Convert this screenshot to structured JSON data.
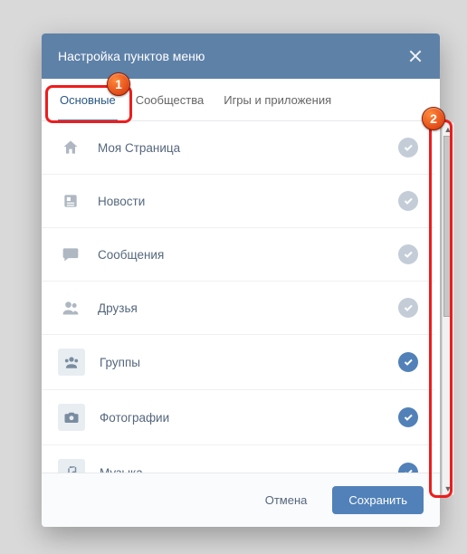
{
  "header": {
    "title": "Настройка пунктов меню"
  },
  "tabs": [
    {
      "label": "Основные",
      "active": true
    },
    {
      "label": "Сообщества",
      "active": false
    },
    {
      "label": "Игры и приложения",
      "active": false
    }
  ],
  "items": [
    {
      "icon": "home-icon",
      "label": "Моя Страница",
      "checked": false,
      "large": false
    },
    {
      "icon": "news-icon",
      "label": "Новости",
      "checked": false,
      "large": false
    },
    {
      "icon": "messages-icon",
      "label": "Сообщения",
      "checked": false,
      "large": false
    },
    {
      "icon": "friends-icon",
      "label": "Друзья",
      "checked": false,
      "large": false
    },
    {
      "icon": "groups-icon",
      "label": "Группы",
      "checked": true,
      "large": true
    },
    {
      "icon": "photos-icon",
      "label": "Фотографии",
      "checked": true,
      "large": true
    },
    {
      "icon": "music-icon",
      "label": "Музыка",
      "checked": true,
      "large": true
    }
  ],
  "footer": {
    "cancel": "Отмена",
    "save": "Сохранить"
  },
  "annotations": {
    "marker1": "1",
    "marker2": "2"
  }
}
